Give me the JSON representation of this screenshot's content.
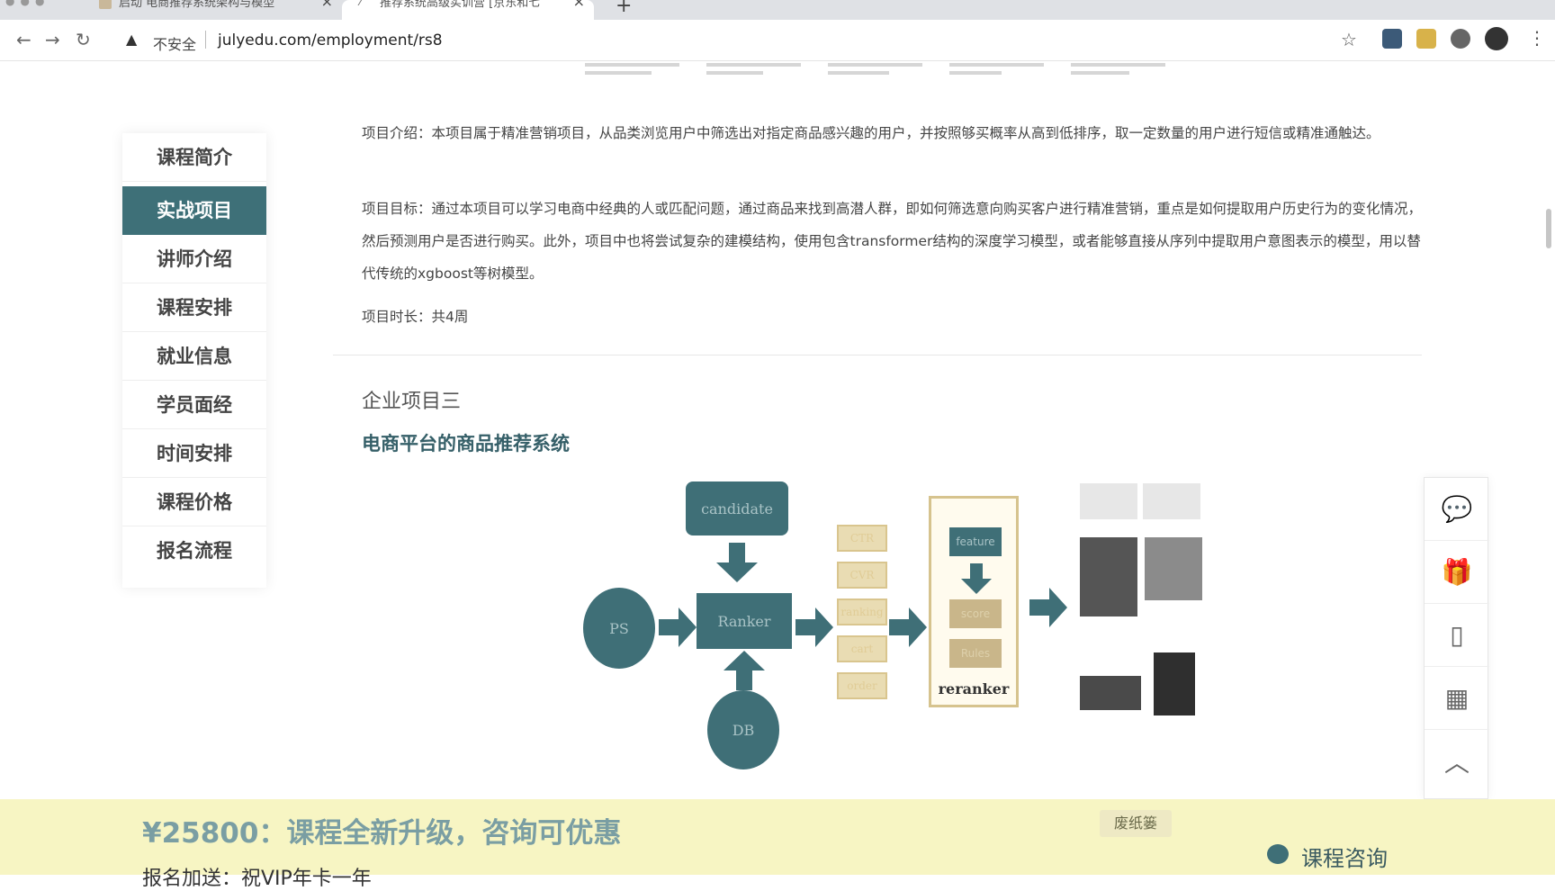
{
  "browser": {
    "tabs": [
      {
        "label": "启动 电商推荐系统架构与模型"
      },
      {
        "label": "推荐系统高级实训营 [京东和七"
      }
    ],
    "address": {
      "security_label": "不安全",
      "url": "julyedu.com/employment/rs8"
    }
  },
  "sidebar": {
    "items": [
      {
        "label": "课程简介"
      },
      {
        "label": "实战项目"
      },
      {
        "label": "讲师介绍"
      },
      {
        "label": "课程安排"
      },
      {
        "label": "就业信息"
      },
      {
        "label": "学员面经"
      },
      {
        "label": "时间安排"
      },
      {
        "label": "课程价格"
      },
      {
        "label": "报名流程"
      }
    ],
    "active": "实战项目"
  },
  "content": {
    "intro": "项目介绍：本项目属于精准营销项目，从品类浏览用户中筛选出对指定商品感兴趣的用户，并按照够买概率从高到低排序，取一定数量的用户进行短信或精准通触达。",
    "goal": "项目目标：通过本项目可以学习电商中经典的人或匹配问题，通过商品来找到高潜人群，即如何筛选意向购买客户进行精准营销，重点是如何提取用户历史行为的变化情况，然后预测用户是否进行购买。此外，项目中也将尝试复杂的建模结构，使用包含transformer结构的深度学习模型，或者能够直接从序列中提取用户意图表示的模型，用以替代传统的xgboost等树模型。",
    "duration": "项目时长：共4周",
    "section_label": "企业项目三",
    "section_title": "电商平台的商品推荐系统"
  },
  "diagram": {
    "candidate": "candidate",
    "ranker": "Ranker",
    "ps": "PS",
    "db": "DB",
    "features": [
      "CTR",
      "CVR",
      "ranking",
      "cart",
      "order"
    ],
    "rerank_feature": "feature",
    "rerank_score": "score",
    "rerank_rules": "Rules",
    "reranker": "reranker"
  },
  "tools": [
    "chat-icon",
    "gift-icon",
    "phone-icon",
    "qrcode-icon",
    "back-to-top-icon"
  ],
  "banner": {
    "price_text": "¥25800：课程全新升级，咨询可优惠",
    "enroll_text": "报名加送：祝VIP年卡一年",
    "tag": "废纸篓",
    "consult": "课程咨询"
  },
  "colors": {
    "accent": "#3e7078",
    "banner_bg": "#f7f5c3"
  }
}
